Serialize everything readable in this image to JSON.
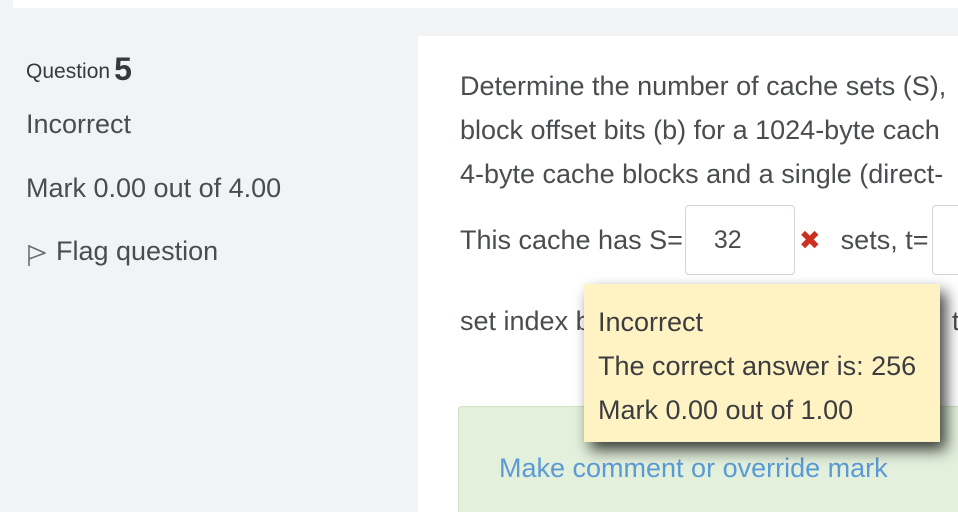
{
  "question": {
    "label": "Question",
    "number": "5",
    "state": "Incorrect",
    "grade": "Mark 0.00 out of 4.00",
    "flag_label": "Flag question"
  },
  "qtext": {
    "line1": "Determine the number of cache sets (S),",
    "line2": "block offset bits (b) for a 1024-byte cach",
    "line3": "4-byte cache blocks and a single (direct-"
  },
  "answer": {
    "prefix": "This cache has S=",
    "value": "32",
    "mark_icon": "cross-icon",
    "mark_glyph": "✖",
    "after": "sets,  t=",
    "next_value": ""
  },
  "setindex": {
    "text": "set index b",
    "tail": "t c"
  },
  "feedback": {
    "state": "Incorrect",
    "right_answer": "The correct answer is: 256",
    "mark": "Mark 0.00 out of 1.00"
  },
  "comment": {
    "link": "Make comment or override mark"
  },
  "colors": {
    "incorrect": "#ca3120",
    "link": "#5b9bd5",
    "tooltip_bg": "#fff2c3",
    "comment_bg": "#e3f0dc"
  }
}
